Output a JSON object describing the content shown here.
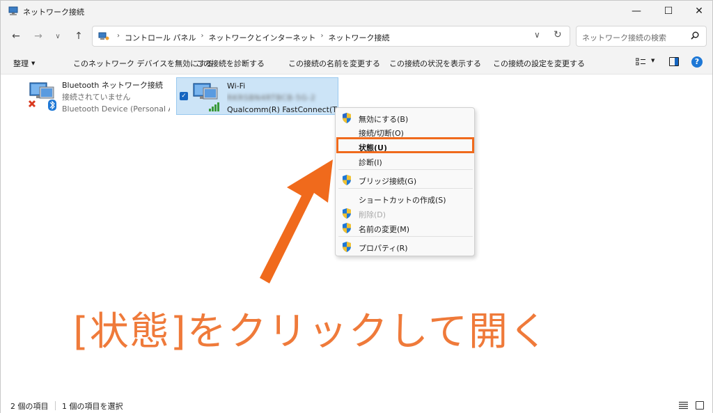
{
  "window": {
    "title": "ネットワーク接続"
  },
  "address": {
    "crumbs": [
      "コントロール パネル",
      "ネットワークとインターネット",
      "ネットワーク接続"
    ],
    "search_placeholder": "ネットワーク接続の検索"
  },
  "commands": {
    "organize": "整理",
    "items": [
      "このネットワーク デバイスを無効にする",
      "この接続を診断する",
      "この接続の名前を変更する",
      "この接続の状況を表示する",
      "この接続の設定を変更する"
    ]
  },
  "connections": [
    {
      "name": "Bluetooth ネットワーク接続",
      "status": "接続されていません",
      "device": "Bluetooth Device (Personal Ar..."
    },
    {
      "name": "Wi-Fi",
      "status": "RKRSBN4RTBCB-5G-2",
      "device": "Qualcomm(R) FastConnect(T..."
    }
  ],
  "context_menu": {
    "items": [
      {
        "label": "無効にする(B)",
        "shield": true
      },
      {
        "label": "接続/切断(O)",
        "shield": false
      },
      {
        "label": "状態(U)",
        "shield": false
      },
      {
        "label": "診断(I)",
        "shield": false
      },
      {
        "label": "ブリッジ接続(G)",
        "shield": true
      },
      {
        "label": "ショートカットの作成(S)",
        "shield": false
      },
      {
        "label": "削除(D)",
        "shield": true
      },
      {
        "label": "名前の変更(M)",
        "shield": true
      },
      {
        "label": "プロパティ(R)",
        "shield": true
      }
    ]
  },
  "annotation": {
    "caption": "[状態]をクリックして開く",
    "color": "#f06a1c"
  },
  "status": {
    "count": "2 個の項目",
    "selected": "1 個の項目を選択"
  },
  "colors": {
    "accent": "#1565c0",
    "selection": "#cce4f7",
    "highlight": "#f06a1c"
  }
}
